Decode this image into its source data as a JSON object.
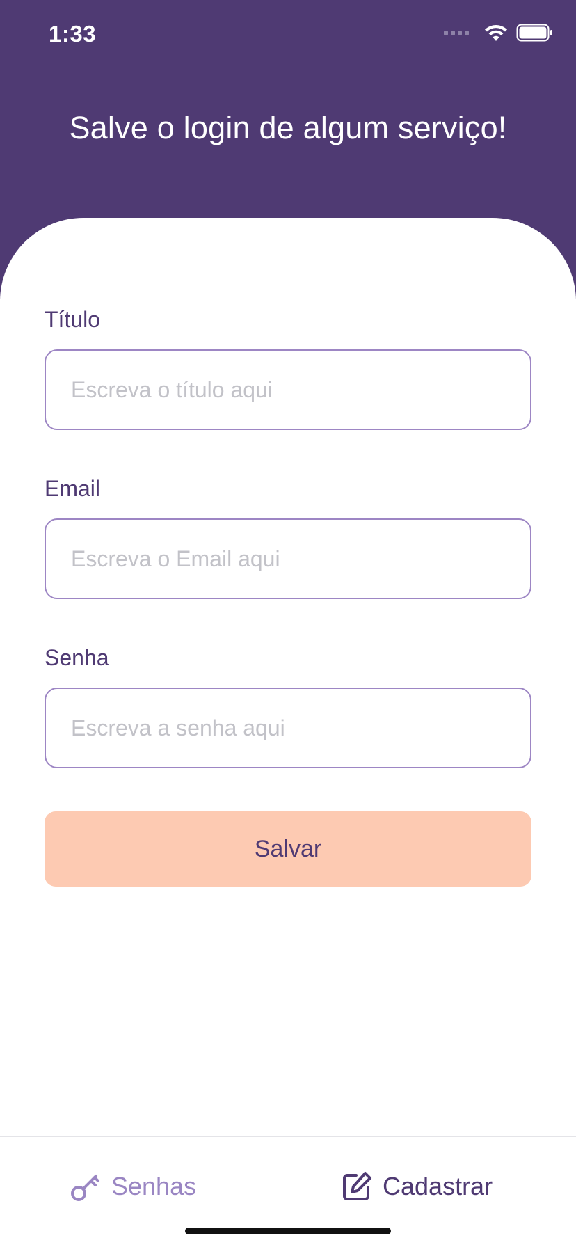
{
  "status_bar": {
    "time": "1:33"
  },
  "header": {
    "title": "Salve o login de algum serviço!"
  },
  "form": {
    "fields": [
      {
        "label": "Título",
        "placeholder": "Escreva o título aqui",
        "value": ""
      },
      {
        "label": "Email",
        "placeholder": "Escreva o Email aqui",
        "value": ""
      },
      {
        "label": "Senha",
        "placeholder": "Escreva a senha aqui",
        "value": ""
      }
    ],
    "save_label": "Salvar"
  },
  "tabbar": {
    "tabs": [
      {
        "label": "Senhas",
        "icon": "key-icon",
        "active": false
      },
      {
        "label": "Cadastrar",
        "icon": "edit-icon",
        "active": true
      }
    ]
  },
  "colors": {
    "primary": "#4f3a73",
    "accent": "#fdcab2",
    "input_border": "#9d86c4",
    "inactive_tab": "#9a86c3"
  }
}
